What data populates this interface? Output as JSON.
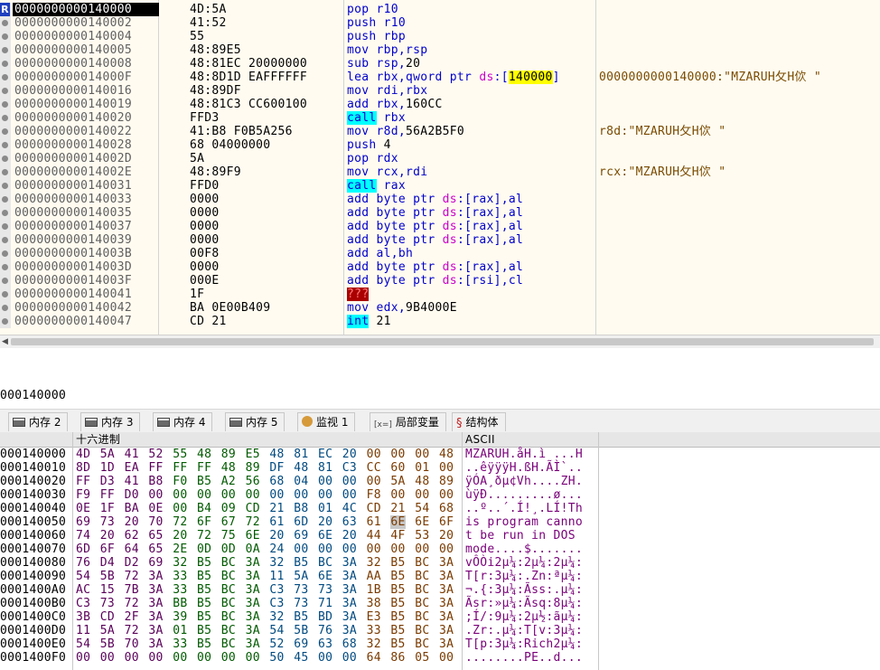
{
  "disasm": {
    "rows": [
      {
        "addr": "0000000000140000",
        "bytes": "4D:5A",
        "op": "pop",
        "args": [
          [
            "reg",
            "r10"
          ]
        ],
        "cmt": "",
        "rip": true
      },
      {
        "addr": "0000000000140002",
        "bytes": "41:52",
        "op": "push",
        "args": [
          [
            "reg",
            "r10"
          ]
        ],
        "cmt": ""
      },
      {
        "addr": "0000000000140004",
        "bytes": "55",
        "op": "push",
        "args": [
          [
            "reg",
            "rbp"
          ]
        ],
        "cmt": ""
      },
      {
        "addr": "0000000000140005",
        "bytes": "48:89E5",
        "op": "mov",
        "args": [
          [
            "reg",
            "rbp,rsp"
          ]
        ],
        "cmt": ""
      },
      {
        "addr": "0000000000140008",
        "bytes": "48:81EC 20000000",
        "op": "sub",
        "args": [
          [
            "reg",
            "rsp,"
          ],
          [
            "imm",
            "20"
          ]
        ],
        "cmt": ""
      },
      {
        "addr": "000000000014000F",
        "bytes": "48:8D1D EAFFFFFF",
        "op": "lea",
        "args": [
          [
            "reg",
            "rbx,qword ptr "
          ],
          [
            "seg",
            "ds"
          ],
          [
            "reg",
            ":["
          ],
          [
            "immy",
            "140000"
          ],
          [
            "reg",
            "]"
          ]
        ],
        "cmt": "0000000000140000:\"MZARUH攵H佽 \""
      },
      {
        "addr": "0000000000140016",
        "bytes": "48:89DF",
        "op": "mov",
        "args": [
          [
            "reg",
            "rdi,rbx"
          ]
        ],
        "cmt": ""
      },
      {
        "addr": "0000000000140019",
        "bytes": "48:81C3 CC600100",
        "op": "add",
        "args": [
          [
            "reg",
            "rbx,"
          ],
          [
            "imm",
            "160CC"
          ]
        ],
        "cmt": ""
      },
      {
        "addr": "0000000000140020",
        "bytes": "FFD3",
        "op": "call",
        "call": true,
        "args": [
          [
            "reg",
            "rbx"
          ]
        ],
        "cmt": ""
      },
      {
        "addr": "0000000000140022",
        "bytes": "41:B8 F0B5A256",
        "op": "mov",
        "args": [
          [
            "reg",
            "r8d,"
          ],
          [
            "imm",
            "56A2B5F0"
          ]
        ],
        "cmt": "r8d:\"MZARUH攵H佽 \""
      },
      {
        "addr": "0000000000140028",
        "bytes": "68 04000000",
        "op": "push",
        "args": [
          [
            "imm",
            "4"
          ]
        ],
        "cmt": ""
      },
      {
        "addr": "000000000014002D",
        "bytes": "5A",
        "op": "pop",
        "args": [
          [
            "reg",
            "rdx"
          ]
        ],
        "cmt": ""
      },
      {
        "addr": "000000000014002E",
        "bytes": "48:89F9",
        "op": "mov",
        "args": [
          [
            "reg",
            "rcx,rdi"
          ]
        ],
        "cmt": "rcx:\"MZARUH攵H佽 \""
      },
      {
        "addr": "0000000000140031",
        "bytes": "FFD0",
        "op": "call",
        "call": true,
        "args": [
          [
            "reg",
            "rax"
          ]
        ],
        "cmt": ""
      },
      {
        "addr": "0000000000140033",
        "bytes": "0000",
        "op": "add",
        "args": [
          [
            "reg",
            "byte ptr "
          ],
          [
            "seg",
            "ds"
          ],
          [
            "reg",
            ":[rax],al"
          ]
        ],
        "cmt": ""
      },
      {
        "addr": "0000000000140035",
        "bytes": "0000",
        "op": "add",
        "args": [
          [
            "reg",
            "byte ptr "
          ],
          [
            "seg",
            "ds"
          ],
          [
            "reg",
            ":[rax],al"
          ]
        ],
        "cmt": ""
      },
      {
        "addr": "0000000000140037",
        "bytes": "0000",
        "op": "add",
        "args": [
          [
            "reg",
            "byte ptr "
          ],
          [
            "seg",
            "ds"
          ],
          [
            "reg",
            ":[rax],al"
          ]
        ],
        "cmt": ""
      },
      {
        "addr": "0000000000140039",
        "bytes": "0000",
        "op": "add",
        "args": [
          [
            "reg",
            "byte ptr "
          ],
          [
            "seg",
            "ds"
          ],
          [
            "reg",
            ":[rax],al"
          ]
        ],
        "cmt": ""
      },
      {
        "addr": "000000000014003B",
        "bytes": "00F8",
        "op": "add",
        "args": [
          [
            "reg",
            "al,bh"
          ]
        ],
        "cmt": ""
      },
      {
        "addr": "000000000014003D",
        "bytes": "0000",
        "op": "add",
        "args": [
          [
            "reg",
            "byte ptr "
          ],
          [
            "seg",
            "ds"
          ],
          [
            "reg",
            ":[rax],al"
          ]
        ],
        "cmt": ""
      },
      {
        "addr": "000000000014003F",
        "bytes": "000E",
        "op": "add",
        "args": [
          [
            "reg",
            "byte ptr "
          ],
          [
            "seg",
            "ds"
          ],
          [
            "reg",
            ":[rsi],cl"
          ]
        ],
        "cmt": ""
      },
      {
        "addr": "0000000000140041",
        "bytes": "1F",
        "op": "???",
        "bad": true,
        "args": [],
        "cmt": ""
      },
      {
        "addr": "0000000000140042",
        "bytes": "BA 0E00B409",
        "op": "mov",
        "args": [
          [
            "reg",
            "edx,"
          ],
          [
            "imm",
            "9B4000E"
          ]
        ],
        "cmt": ""
      },
      {
        "addr": "0000000000140047",
        "bytes": "CD 21",
        "op": "int",
        "call": true,
        "args": [
          [
            "imm",
            "21"
          ]
        ],
        "cmt": ""
      }
    ]
  },
  "goto_address": "000140000",
  "tabs": [
    {
      "label": "内存 2",
      "icon": "memory-icon"
    },
    {
      "label": "内存 3",
      "icon": "memory-icon"
    },
    {
      "label": "内存 4",
      "icon": "memory-icon"
    },
    {
      "label": "内存 5",
      "icon": "memory-icon"
    },
    {
      "label": "监视 1",
      "icon": "watch-icon"
    },
    {
      "label": "局部变量",
      "icon": "local-vars-icon",
      "prefix": "[x=]"
    },
    {
      "label": "结构体",
      "icon": "struct-icon"
    }
  ],
  "dump": {
    "header_hex": "十六进制",
    "header_ascii": "ASCII",
    "rows": [
      {
        "addr": "000140000",
        "hex": [
          "4D",
          "5A",
          "41",
          "52",
          "55",
          "48",
          "89",
          "E5",
          "48",
          "81",
          "EC",
          "20",
          "00",
          "00",
          "00",
          "48"
        ],
        "ascii": "MZARUH.åH.ì ...H"
      },
      {
        "addr": "000140010",
        "hex": [
          "8D",
          "1D",
          "EA",
          "FF",
          "FF",
          "FF",
          "48",
          "89",
          "DF",
          "48",
          "81",
          "C3",
          "CC",
          "60",
          "01",
          "00"
        ],
        "ascii": "..êÿÿÿH.ßH.ÃÌ`.."
      },
      {
        "addr": "000140020",
        "hex": [
          "FF",
          "D3",
          "41",
          "B8",
          "F0",
          "B5",
          "A2",
          "56",
          "68",
          "04",
          "00",
          "00",
          "00",
          "5A",
          "48",
          "89"
        ],
        "ascii": "ÿÓA¸ðµ¢Vh....ZH."
      },
      {
        "addr": "000140030",
        "hex": [
          "F9",
          "FF",
          "D0",
          "00",
          "00",
          "00",
          "00",
          "00",
          "00",
          "00",
          "00",
          "00",
          "F8",
          "00",
          "00",
          "00"
        ],
        "ascii": "ùÿÐ.........ø..."
      },
      {
        "addr": "000140040",
        "hex": [
          "0E",
          "1F",
          "BA",
          "0E",
          "00",
          "B4",
          "09",
          "CD",
          "21",
          "B8",
          "01",
          "4C",
          "CD",
          "21",
          "54",
          "68"
        ],
        "ascii": "..º..´.Í!¸.LÍ!Th"
      },
      {
        "addr": "000140050",
        "hex": [
          "69",
          "73",
          "20",
          "70",
          "72",
          "6F",
          "67",
          "72",
          "61",
          "6D",
          "20",
          "63",
          "61",
          "6E",
          "6E",
          "6F"
        ],
        "ascii": "is program canno",
        "sel": 13
      },
      {
        "addr": "000140060",
        "hex": [
          "74",
          "20",
          "62",
          "65",
          "20",
          "72",
          "75",
          "6E",
          "20",
          "69",
          "6E",
          "20",
          "44",
          "4F",
          "53",
          "20"
        ],
        "ascii": "t be run in DOS "
      },
      {
        "addr": "000140070",
        "hex": [
          "6D",
          "6F",
          "64",
          "65",
          "2E",
          "0D",
          "0D",
          "0A",
          "24",
          "00",
          "00",
          "00",
          "00",
          "00",
          "00",
          "00"
        ],
        "ascii": "mode....$......."
      },
      {
        "addr": "000140080",
        "hex": [
          "76",
          "D4",
          "D2",
          "69",
          "32",
          "B5",
          "BC",
          "3A",
          "32",
          "B5",
          "BC",
          "3A",
          "32",
          "B5",
          "BC",
          "3A"
        ],
        "ascii": "vÔÒi2µ¼:2µ¼:2µ¼:"
      },
      {
        "addr": "000140090",
        "hex": [
          "54",
          "5B",
          "72",
          "3A",
          "33",
          "B5",
          "BC",
          "3A",
          "11",
          "5A",
          "6E",
          "3A",
          "AA",
          "B5",
          "BC",
          "3A"
        ],
        "ascii": "T[r:3µ¼:.Zn:ªµ¼:"
      },
      {
        "addr": "0001400A0",
        "hex": [
          "AC",
          "15",
          "7B",
          "3A",
          "33",
          "B5",
          "BC",
          "3A",
          "C3",
          "73",
          "73",
          "3A",
          "1B",
          "B5",
          "BC",
          "3A"
        ],
        "ascii": "¬.{:3µ¼:Ãss:.µ¼:"
      },
      {
        "addr": "0001400B0",
        "hex": [
          "C3",
          "73",
          "72",
          "3A",
          "BB",
          "B5",
          "BC",
          "3A",
          "C3",
          "73",
          "71",
          "3A",
          "38",
          "B5",
          "BC",
          "3A"
        ],
        "ascii": "Ãsr:»µ¼:Ãsq:8µ¼:"
      },
      {
        "addr": "0001400C0",
        "hex": [
          "3B",
          "CD",
          "2F",
          "3A",
          "39",
          "B5",
          "BC",
          "3A",
          "32",
          "B5",
          "BD",
          "3A",
          "E3",
          "B5",
          "BC",
          "3A"
        ],
        "ascii": ";Í/:9µ¼:2µ½:ãµ¼:"
      },
      {
        "addr": "0001400D0",
        "hex": [
          "11",
          "5A",
          "72",
          "3A",
          "01",
          "B5",
          "BC",
          "3A",
          "54",
          "5B",
          "76",
          "3A",
          "33",
          "B5",
          "BC",
          "3A"
        ],
        "ascii": ".Zr:.µ¼:T[v:3µ¼:"
      },
      {
        "addr": "0001400E0",
        "hex": [
          "54",
          "5B",
          "70",
          "3A",
          "33",
          "B5",
          "BC",
          "3A",
          "52",
          "69",
          "63",
          "68",
          "32",
          "B5",
          "BC",
          "3A"
        ],
        "ascii": "T[p:3µ¼:Rich2µ¼:"
      },
      {
        "addr": "0001400F0",
        "hex": [
          "00",
          "00",
          "00",
          "00",
          "00",
          "00",
          "00",
          "00",
          "50",
          "45",
          "00",
          "00",
          "64",
          "86",
          "05",
          "00"
        ],
        "ascii": "........PE..d..."
      }
    ]
  }
}
